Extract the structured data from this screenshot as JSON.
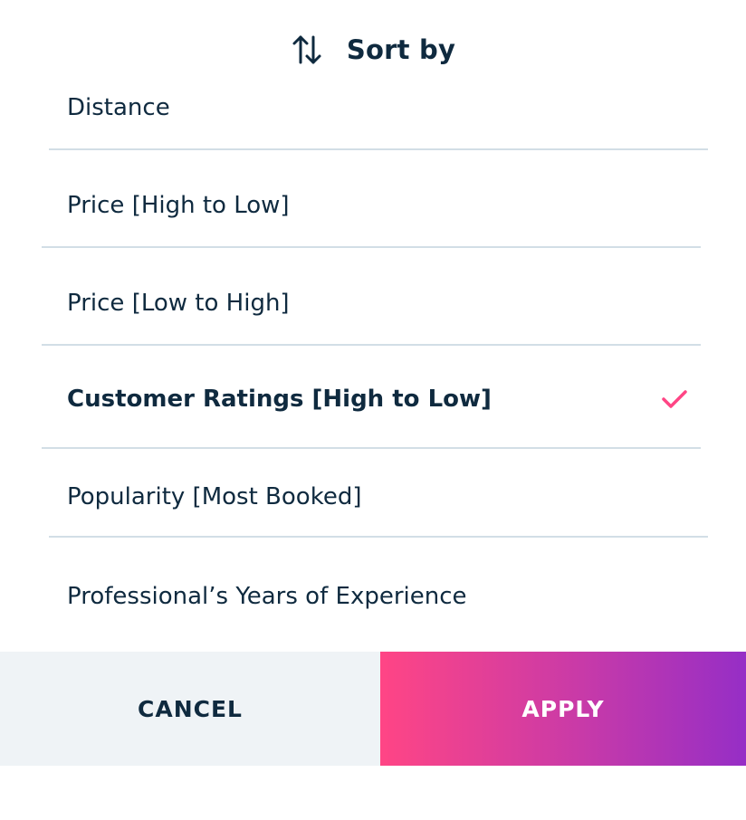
{
  "header": {
    "icon": "sort-arrows-icon",
    "title": "Sort by"
  },
  "options": [
    {
      "label": "Distance",
      "selected": false
    },
    {
      "label": "Price [High to Low]",
      "selected": false
    },
    {
      "label": "Price [Low to High]",
      "selected": false
    },
    {
      "label": "Customer Ratings [High to Low]",
      "selected": true
    },
    {
      "label": "Popularity [Most Booked]",
      "selected": false
    },
    {
      "label": "Professional’s Years of Experience",
      "selected": false
    }
  ],
  "selected_icon": "checkmark-icon",
  "footer": {
    "cancel_label": "CANCEL",
    "apply_label": "APPLY"
  },
  "colors": {
    "text": "#0f2a3f",
    "accent": "#ff4585",
    "divider": "#d2dee6",
    "cancel_bg": "#eff3f6",
    "apply_gradient_start": "#ff4585",
    "apply_gradient_end": "#962ec6"
  }
}
